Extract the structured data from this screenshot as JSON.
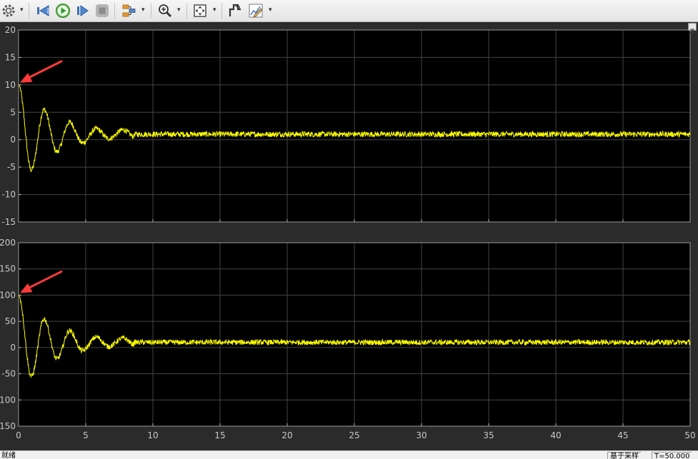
{
  "toolbar": {
    "icons": [
      "settings-icon",
      "back-icon",
      "run-icon",
      "step-forward-icon",
      "stop-icon",
      "signal-select-icon",
      "zoom-in-icon",
      "fit-to-view-icon",
      "highlight-icon",
      "style-icon"
    ]
  },
  "status": {
    "left_text": "就绪",
    "sample_mode": "基于采样",
    "time": "T=50.000"
  },
  "colors": {
    "trace": "#ffff00",
    "plot_bg": "#000000",
    "arrow": "#ff3a3a"
  },
  "chart_data": [
    {
      "type": "line",
      "title": "",
      "xlabel": "",
      "ylabel": "",
      "xlim": [
        0,
        50
      ],
      "ylim": [
        -15,
        20
      ],
      "xticks": [
        0,
        5,
        10,
        15,
        20,
        25,
        30,
        35,
        40,
        45,
        50
      ],
      "yticks": [
        20,
        15,
        10,
        5,
        0,
        -5,
        -10,
        -15
      ],
      "grid": true,
      "series": [
        {
          "color": "#ffff00",
          "peaks": [
            [
              0,
              10
            ],
            [
              0.95,
              -5.5
            ],
            [
              1.9,
              5.5
            ],
            [
              2.85,
              -2.2
            ],
            [
              3.8,
              3.2
            ],
            [
              4.75,
              -0.6
            ],
            [
              5.8,
              2.0
            ],
            [
              6.7,
              0.2
            ],
            [
              7.8,
              1.8
            ],
            [
              8.6,
              0.6
            ]
          ],
          "steady_state": 1.0,
          "noise_amplitude": 0.5
        }
      ],
      "annotation": {
        "type": "arrow",
        "target": [
          0,
          10
        ]
      }
    },
    {
      "type": "line",
      "title": "",
      "xlabel": "",
      "ylabel": "",
      "xlim": [
        0,
        50
      ],
      "ylim": [
        -150,
        200
      ],
      "xticks": [
        0,
        5,
        10,
        15,
        20,
        25,
        30,
        35,
        40,
        45,
        50
      ],
      "yticks": [
        200,
        150,
        100,
        50,
        0,
        -50,
        -100,
        -150
      ],
      "grid": true,
      "series": [
        {
          "color": "#ffff00",
          "peaks": [
            [
              0,
              100
            ],
            [
              0.95,
              -55
            ],
            [
              1.9,
              55
            ],
            [
              2.85,
              -22
            ],
            [
              3.8,
              32
            ],
            [
              4.75,
              -6
            ],
            [
              5.8,
              20
            ],
            [
              6.7,
              2
            ],
            [
              7.8,
              18
            ],
            [
              8.6,
              6
            ]
          ],
          "steady_state": 10,
          "noise_amplitude": 5
        }
      ],
      "annotation": {
        "type": "arrow",
        "target": [
          0,
          100
        ]
      }
    }
  ]
}
